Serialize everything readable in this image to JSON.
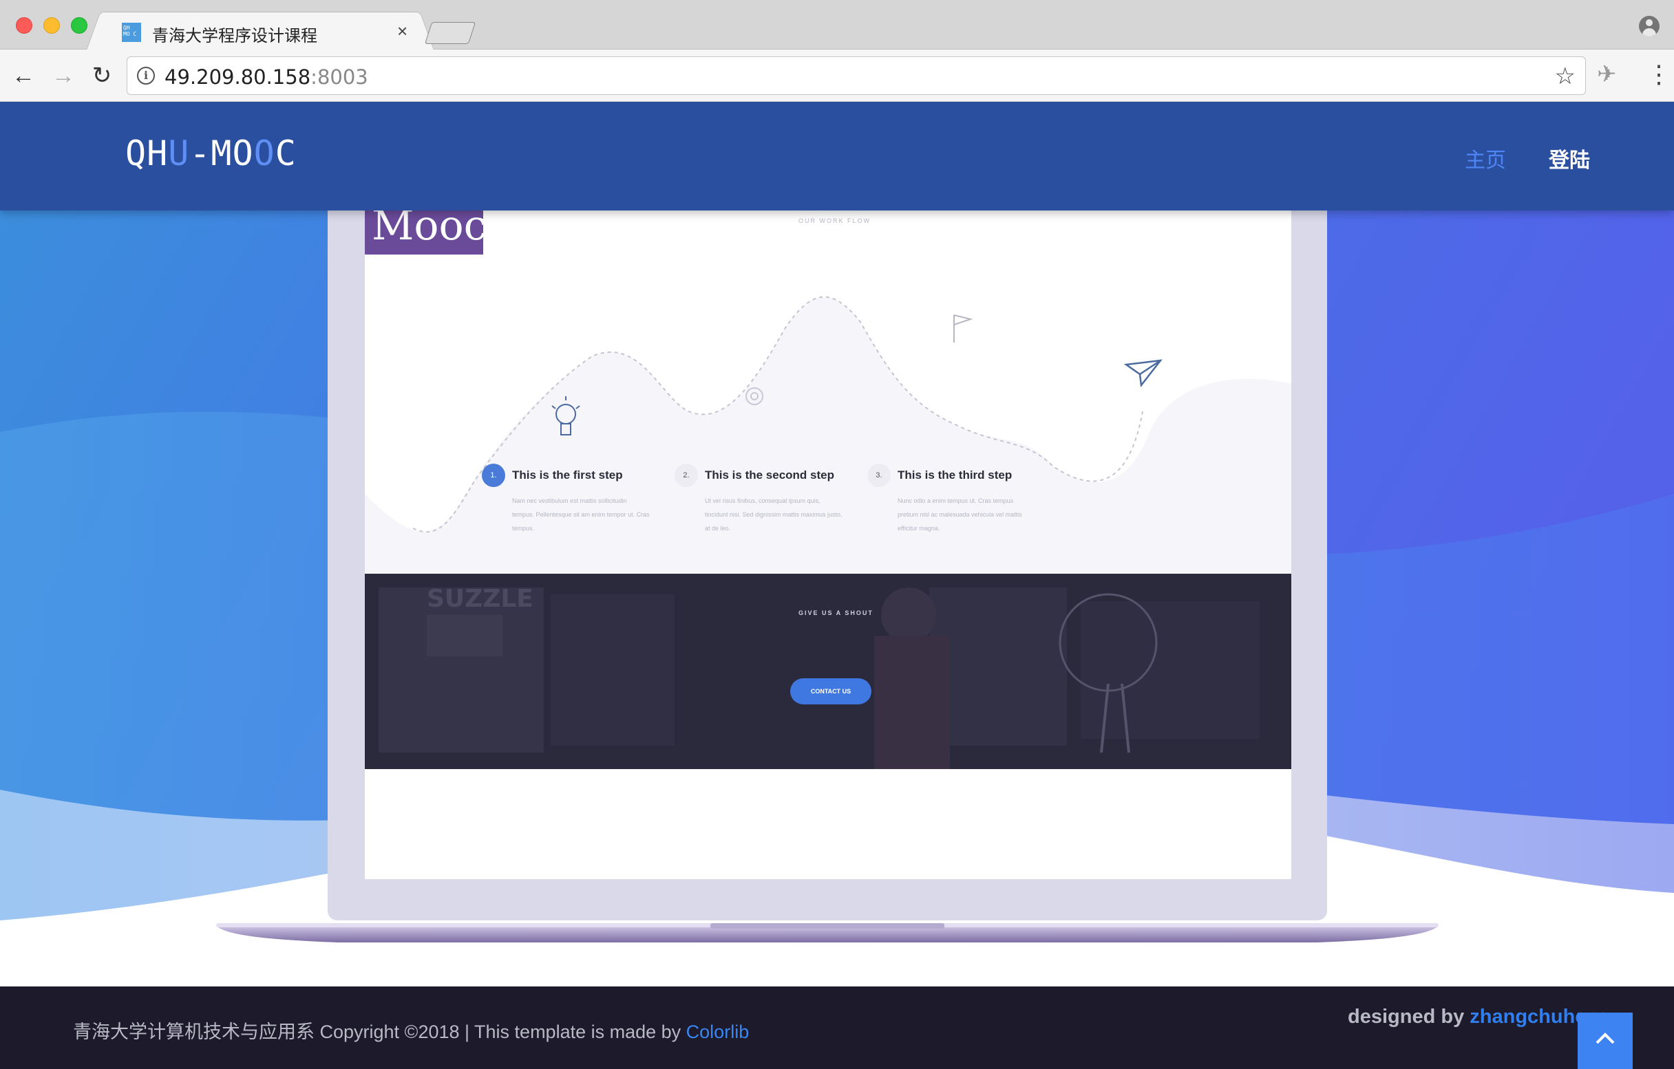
{
  "browser": {
    "tab_title": "青海大学程序设计课程",
    "favicon_text": "QH MO C",
    "url_host": "49.209.80.158",
    "url_port": ":8003"
  },
  "site": {
    "logo": {
      "p1": "QH",
      "p2": "U",
      "p3": "-MO",
      "p4": "O",
      "p5": "C"
    },
    "nav": {
      "home": "主页",
      "login": "登陆"
    },
    "accent_color": "#4f86f7",
    "header_color": "#2a4f9e"
  },
  "laptop_content": {
    "badge": "Mooc",
    "flow_label": "OUR WORK FLOW",
    "steps": [
      {
        "num": "1.",
        "title": "This is the first step",
        "desc": "Nam nec vestibulum est mattis sollicitudin tempus. Pellentesque sit am enim tempor ut. Cras tempus."
      },
      {
        "num": "2.",
        "title": "This is the second step",
        "desc": "Ut vel risus finibus, consequat ipsum quis, tincidunt nisi. Sed dignissim mattis maximus justo, at de leo."
      },
      {
        "num": "3.",
        "title": "This is the third step",
        "desc": "Nunc odio a enim tempus ut. Cras tempus pretium nisl ac malesuada vehicula vel mattis efficitur magna."
      }
    ],
    "cta_label": "GIVE US A SHOUT",
    "cta_button": "CONTACT US"
  },
  "footer": {
    "copyright_prefix": "青海大学计算机技术与应用系 Copyright ©2018 | This template is made by ",
    "copyright_link": "Colorlib",
    "designed_prefix": "designed by ",
    "designed_link": "zhangchuheng"
  }
}
